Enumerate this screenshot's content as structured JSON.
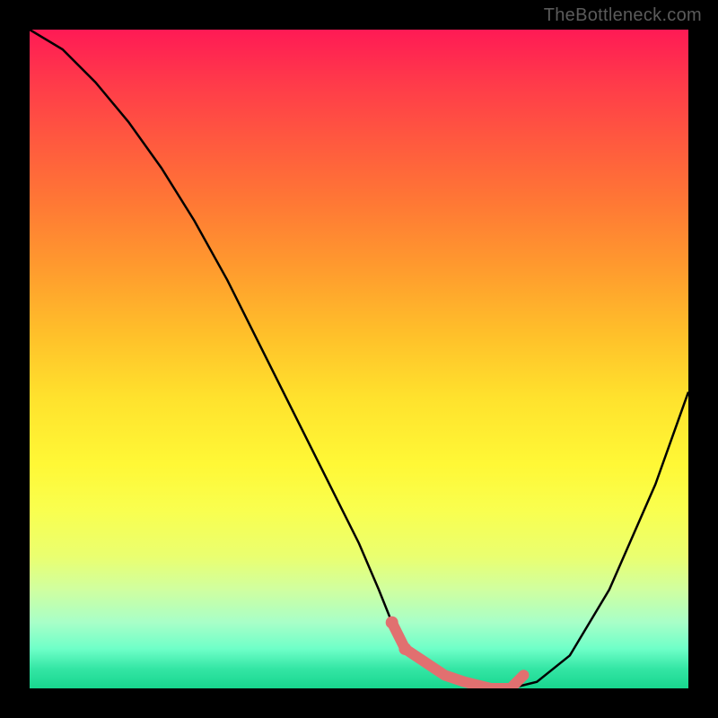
{
  "watermark": "TheBottleneck.com",
  "chart_data": {
    "type": "line",
    "title": "",
    "xlabel": "",
    "ylabel": "",
    "xlim": [
      0,
      100
    ],
    "ylim": [
      0,
      100
    ],
    "series": [
      {
        "name": "bottleneck-curve",
        "x": [
          0,
          5,
          10,
          15,
          20,
          25,
          30,
          35,
          40,
          45,
          50,
          53,
          55,
          57,
          60,
          63,
          66,
          70,
          73,
          77,
          82,
          88,
          95,
          100
        ],
        "y": [
          100,
          97,
          92,
          86,
          79,
          71,
          62,
          52,
          42,
          32,
          22,
          15,
          10,
          6,
          4,
          2,
          1,
          0,
          0,
          1,
          5,
          15,
          31,
          45
        ]
      }
    ],
    "highlight_segment": {
      "name": "optimal-range",
      "x": [
        55,
        57,
        60,
        63,
        66,
        70,
        73,
        75
      ],
      "y": [
        10,
        6,
        4,
        2,
        1,
        0,
        0,
        2
      ]
    },
    "gradient_stops": [
      {
        "pct": 0,
        "color": "#ff1a55"
      },
      {
        "pct": 46,
        "color": "#ffbf2a"
      },
      {
        "pct": 73,
        "color": "#f9ff4f"
      },
      {
        "pct": 100,
        "color": "#18d68e"
      }
    ]
  }
}
